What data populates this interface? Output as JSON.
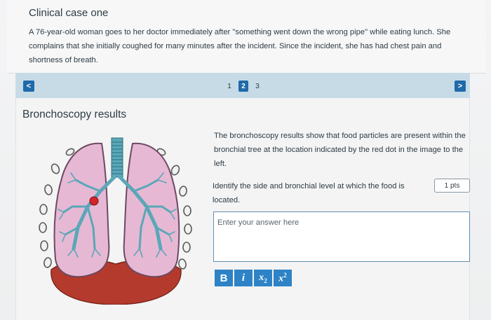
{
  "case": {
    "title": "Clinical case one",
    "body": "A 76-year-old woman goes to her doctor immediately after \"something went down the wrong pipe\" while eating lunch. She complains that she initially coughed for many minutes after the incident. Since the incident, she has had chest pain and shortness of breath."
  },
  "pager": {
    "prev_label": "<",
    "next_label": ">",
    "pages": [
      "1",
      "2",
      "3"
    ],
    "current_page": "2"
  },
  "section": {
    "title": "Bronchoscopy results",
    "results_text": "The bronchoscopy results show that food particles are present within the bronchial tree at the location indicated by the red dot in the image to the left.",
    "question_text": "Identify the side and bronchial level at which the food is located.",
    "points": "1 pts"
  },
  "answer": {
    "value": "",
    "placeholder": "Enter your answer here"
  },
  "toolbar": {
    "bold": "B",
    "italic": "i",
    "subscript": "x",
    "subscript_digit": "2",
    "superscript": "x",
    "superscript_digit": "2"
  },
  "colors": {
    "accent": "#1f6aa8",
    "pager_bg": "#c7dbe7",
    "lung_fill": "#e7b8d4",
    "airway": "#5aa7b8",
    "diaphragm": "#b33a2c",
    "food_dot": "#d1262b"
  }
}
